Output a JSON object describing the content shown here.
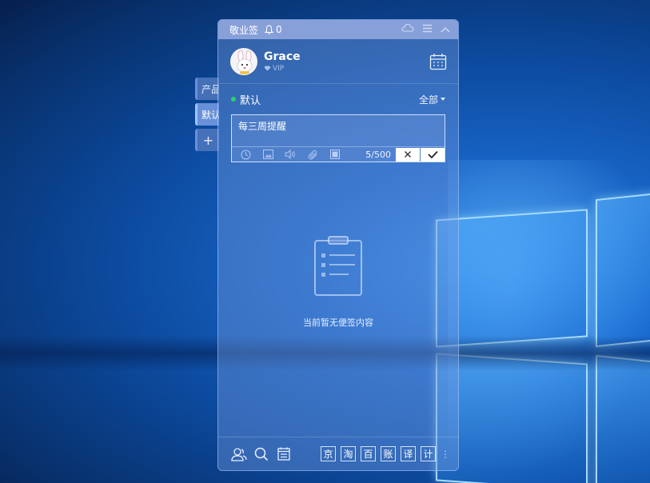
{
  "app": {
    "title": "敬业签",
    "notification_count": "0"
  },
  "side_tabs": [
    {
      "label": "产品"
    },
    {
      "label": "默认"
    },
    {
      "label": "+"
    }
  ],
  "user": {
    "name": "Grace",
    "badge": "VIP"
  },
  "category": {
    "name": "默认",
    "filter": "全部",
    "status_color": "#2bd16c"
  },
  "editor": {
    "text": "每三周提醒",
    "count_current": "5",
    "count_max": "/500"
  },
  "empty_state": {
    "message": "当前暂无便签内容"
  },
  "footer": {
    "tools": [
      "京",
      "淘",
      "百",
      "账",
      "译",
      "计"
    ]
  },
  "icons": [
    "bell-icon",
    "cloud-icon",
    "menu-icon",
    "collapse-icon",
    "calendar-icon",
    "diamond-icon",
    "clock-icon",
    "image-icon",
    "audio-icon",
    "attachment-icon",
    "stop-icon",
    "close-icon",
    "check-icon",
    "clipboard-icon",
    "contacts-icon",
    "search-icon",
    "notes-icon",
    "more-icon"
  ]
}
